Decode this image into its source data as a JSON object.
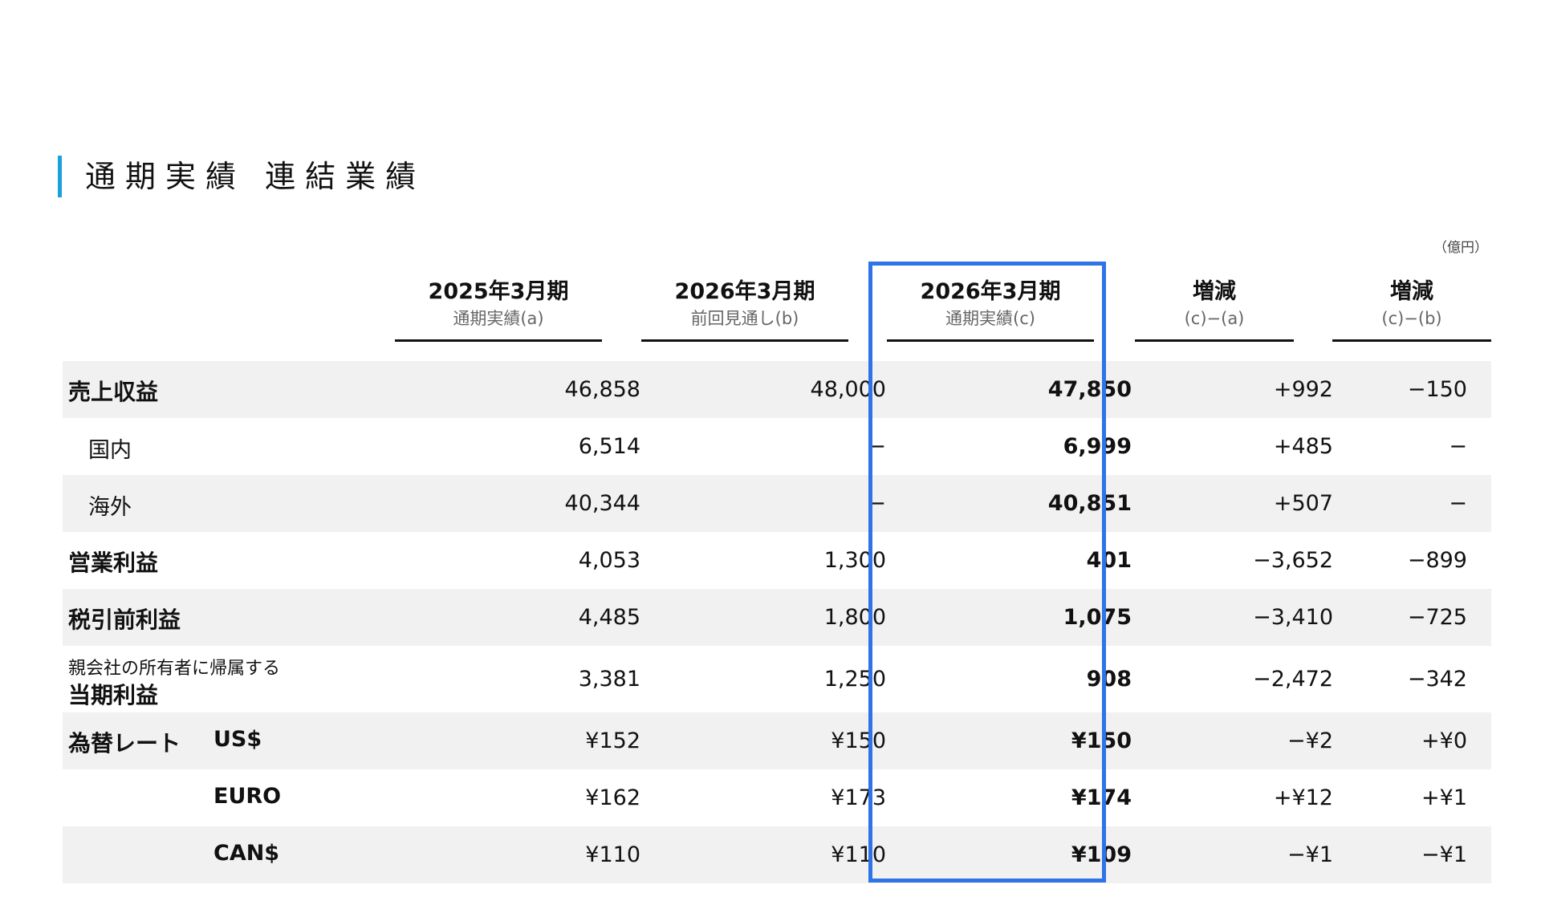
{
  "page": {
    "title": "通期実績 連結業績",
    "unit": "（億円）"
  },
  "columns": [
    {
      "line1": "2025年3月期",
      "line2": "通期実績(a)"
    },
    {
      "line1": "2026年3月期",
      "line2": "前回見通し(b)"
    },
    {
      "line1": "2026年3月期",
      "line2": "通期実績(c)"
    },
    {
      "line1": "増減",
      "line2": "(c)−(a)"
    },
    {
      "line1": "増減",
      "line2": "(c)−(b)"
    }
  ],
  "rows": [
    {
      "label": "売上収益",
      "values": [
        "46,858",
        "48,000",
        "47,850",
        "+992",
        "−150"
      ]
    },
    {
      "label": "国内",
      "values": [
        "6,514",
        "−",
        "6,999",
        "+485",
        "−"
      ]
    },
    {
      "label": "海外",
      "values": [
        "40,344",
        "−",
        "40,851",
        "+507",
        "−"
      ]
    },
    {
      "label": "営業利益",
      "values": [
        "4,053",
        "1,300",
        "401",
        "−3,652",
        "−899"
      ]
    },
    {
      "label": "税引前利益",
      "values": [
        "4,485",
        "1,800",
        "1,075",
        "−3,410",
        "−725"
      ]
    },
    {
      "label_small": "親会社の所有者に帰属する",
      "label": "当期利益",
      "values": [
        "3,381",
        "1,250",
        "908",
        "−2,472",
        "−342"
      ]
    },
    {
      "label": "為替レート",
      "currency": "US$",
      "values": [
        "¥152",
        "¥150",
        "¥150",
        "−¥2",
        "+¥0"
      ]
    },
    {
      "currency": "EURO",
      "values": [
        "¥162",
        "¥173",
        "¥174",
        "+¥12",
        "+¥1"
      ]
    },
    {
      "currency": "CAN$",
      "values": [
        "¥110",
        "¥110",
        "¥109",
        "−¥1",
        "−¥1"
      ]
    }
  ],
  "colors": {
    "accent_bar": "#1aa0e0",
    "highlight": "#2f73e6",
    "row_shade": "#f1f1f1"
  }
}
